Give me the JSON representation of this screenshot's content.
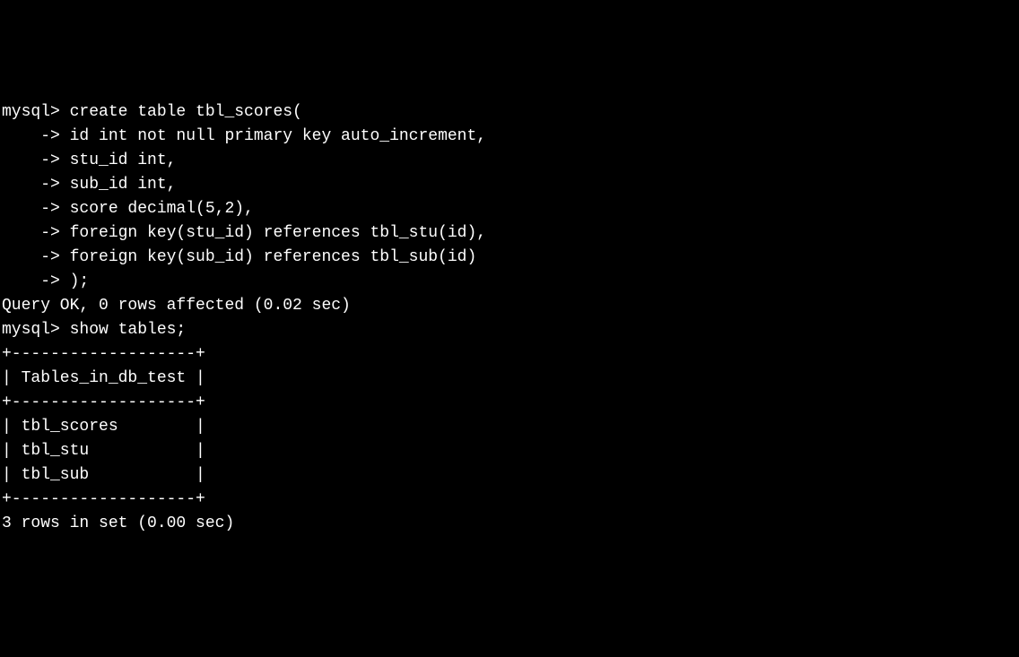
{
  "terminal": {
    "lines": [
      "mysql> create table tbl_scores(",
      "    -> id int not null primary key auto_increment,",
      "    -> stu_id int,",
      "    -> sub_id int,",
      "    -> score decimal(5,2),",
      "    -> foreign key(stu_id) references tbl_stu(id),",
      "    -> foreign key(sub_id) references tbl_sub(id)",
      "    -> );",
      "Query OK, 0 rows affected (0.02 sec)",
      "",
      "mysql> show tables;",
      "+-------------------+",
      "| Tables_in_db_test |",
      "+-------------------+",
      "| tbl_scores        |",
      "| tbl_stu           |",
      "| tbl_sub           |",
      "+-------------------+",
      "3 rows in set (0.00 sec)"
    ]
  }
}
